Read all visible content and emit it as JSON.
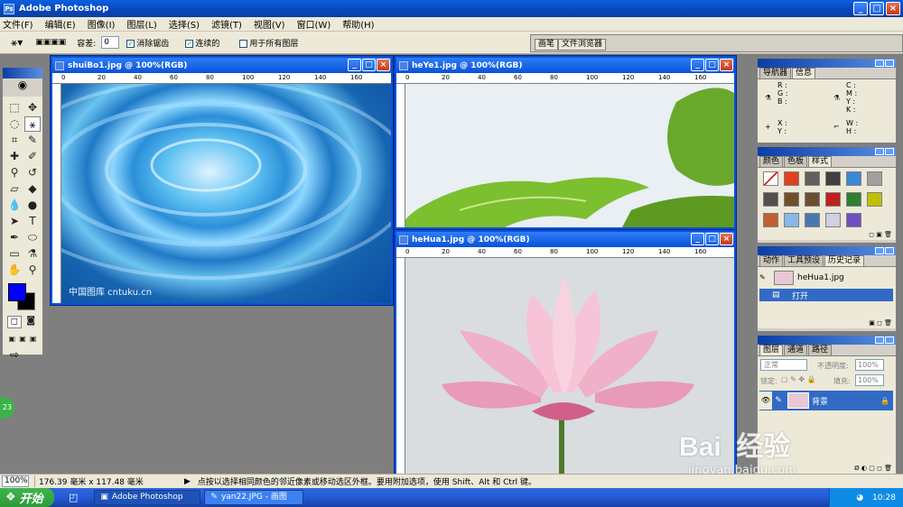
{
  "app": {
    "title": "Adobe Photoshop"
  },
  "menu": [
    "文件(F)",
    "编辑(E)",
    "图像(I)",
    "图层(L)",
    "选择(S)",
    "滤镜(T)",
    "视图(V)",
    "窗口(W)",
    "帮助(H)"
  ],
  "options": {
    "tolerance_label": "容差:",
    "tolerance_value": "0",
    "antialias": "消除锯齿",
    "contiguous": "连续的",
    "all_layers": "用于所有图层"
  },
  "palette_well": {
    "tabs": [
      "画笔",
      "文件浏览器"
    ]
  },
  "ruler_ticks": [
    "0",
    "20",
    "40",
    "60",
    "80",
    "100",
    "120",
    "140",
    "160"
  ],
  "docs": {
    "shuibo": {
      "title": "shuiBo1.jpg @ 100%(RGB)",
      "watermark": "中国图库 cntuku.cn"
    },
    "heye": {
      "title": "heYe1.jpg @ 100%(RGB)"
    },
    "hehua": {
      "title": "heHua1.jpg @ 100%(RGB)"
    }
  },
  "panels": {
    "navigator": {
      "tabs": [
        "导航器",
        "信息"
      ],
      "labels": {
        "rgb": "R :\nG :\nB :",
        "cmyk": "C :\nM :\nY :\nK :",
        "xy": "X :\nY :",
        "wh": "W :\nH :"
      }
    },
    "styles": {
      "tabs": [
        "颜色",
        "色板",
        "样式"
      ],
      "swatches": [
        "#ffffff",
        "#e04020",
        "#606060",
        "#404040",
        "#3a88d8",
        "#a0a0a0",
        "#3060b0",
        "#a08060",
        "#705028",
        "#6a5030",
        "#c02020",
        "#308030",
        "#c0c000",
        "#203040",
        "#c06030",
        "#88b8e8",
        "#4878b0",
        "#d0d0e0",
        "#7050c0"
      ]
    },
    "history": {
      "tabs": [
        "动作",
        "工具预设",
        "历史记录"
      ],
      "snapshot": "heHua1.jpg",
      "step": "打开"
    },
    "layers": {
      "tabs": [
        "图层",
        "通道",
        "路径"
      ],
      "mode": "正常",
      "opacity_label": "不透明度:",
      "opacity": "100%",
      "lock_label": "锁定:",
      "fill_label": "填充:",
      "fill": "100%",
      "layer_name": "背景"
    }
  },
  "status": {
    "zoom": "100%",
    "size": "176.39 毫米 x 117.48 毫米",
    "hint": "点按以选择相同颜色的邻近像素或移动选区外框。要用附加选项，使用 Shift、Alt 和 Ctrl 键。"
  },
  "taskbar": {
    "start": "开始",
    "tasks": [
      "Adobe Photoshop",
      "yan22.JPG - 画图"
    ],
    "time": "10:28"
  },
  "overlay": {
    "badge": "23",
    "baidu": "Bai  经验",
    "baidu_url": "jingyan.baidu.com"
  }
}
